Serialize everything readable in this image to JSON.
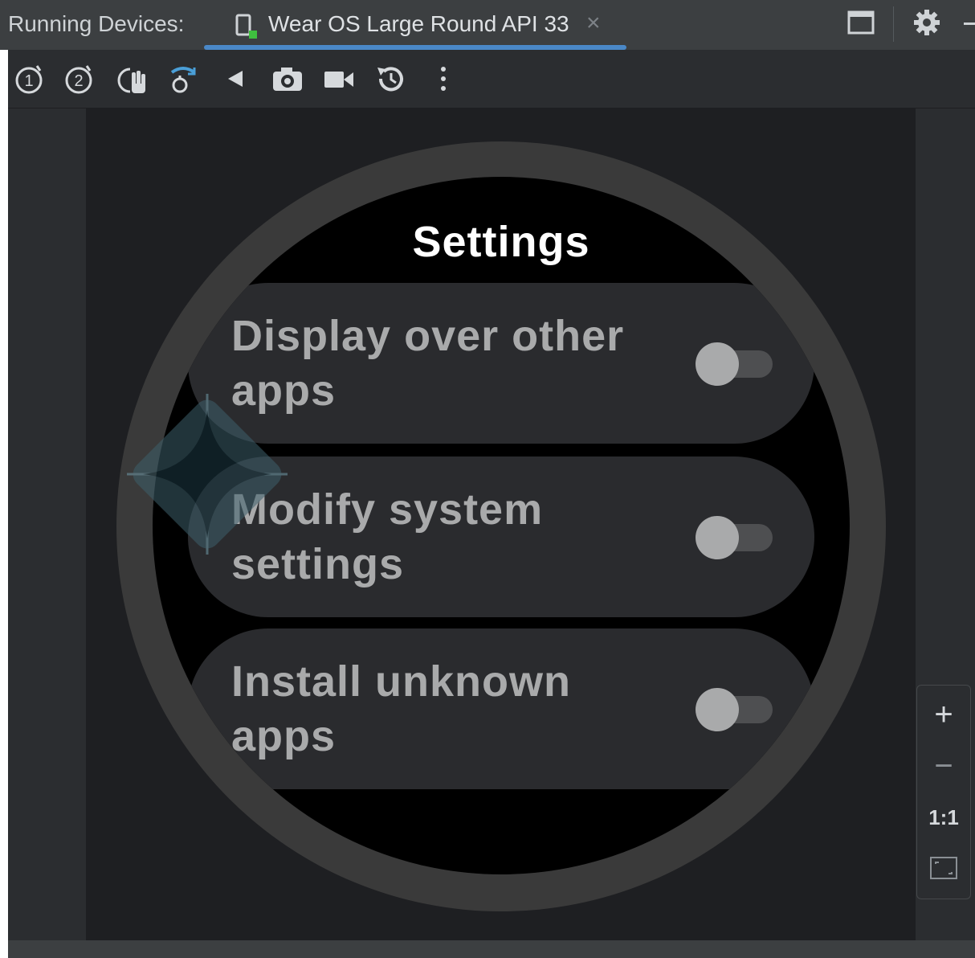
{
  "titlebar": {
    "label": "Running Devices:",
    "tab_name": "Wear OS Large Round API 33",
    "tab_close": "×",
    "accent": "#4a88c7"
  },
  "toolbar": {
    "icons": [
      "power-icon",
      "volume-up-icon",
      "hand-icon",
      "rotate-icon",
      "back-icon",
      "camera-icon",
      "video-icon",
      "snapshot-icon",
      "more-vertical-icon"
    ],
    "accent": "#4a9fd8"
  },
  "watch": {
    "title": "Settings",
    "items": [
      {
        "label": "Display over other apps",
        "enabled": false
      },
      {
        "label": "Modify system settings",
        "enabled": false
      },
      {
        "label": "Install unknown apps",
        "enabled": false
      }
    ]
  },
  "zoom": {
    "zoom_in": "+",
    "zoom_out": "−",
    "actual_size": "1:1",
    "fit_icon": "fit-screen-icon"
  }
}
